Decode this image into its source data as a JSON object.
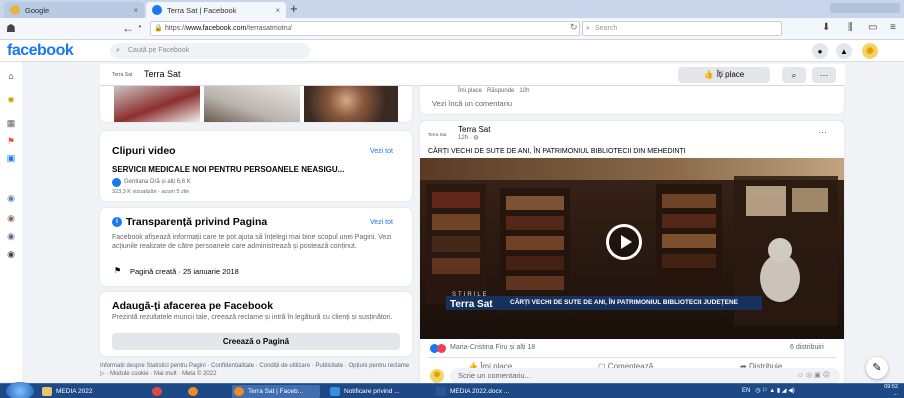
{
  "browser": {
    "tabs": [
      {
        "label": "Google",
        "active": false,
        "icon": "google-icon"
      },
      {
        "label": "Terra Sat | Facebook",
        "active": true,
        "icon": "facebook-icon"
      }
    ],
    "url_prefix": "https://",
    "url_host": "www.facebook.com",
    "url_path": "/terrasatmotru/",
    "search_placeholder": "Search"
  },
  "facebook": {
    "logo": "facebook",
    "search_placeholder": "Caută pe Facebook",
    "brand_color": "#1877f2"
  },
  "page": {
    "mini_logo": "Terra Sat",
    "name": "Terra Sat",
    "like_label": "Îți place"
  },
  "videos_card": {
    "title": "Clipuri video",
    "see_all": "Vezi tot",
    "video_title": "SERVICII MEDICALE NOI PENTRU PERSOANELE NEASIGU...",
    "reactions": "Gentiana Dră și alți 6,6 K",
    "stats": "323,3 K vizualizări · acum 5 zile"
  },
  "transparency_card": {
    "title": "Transparență privind Pagina",
    "see_all": "Vezi tot",
    "description": "Facebook afișează informații care te pot ajuta să înțelegi mai bine scopul unei Pagini. Vezi acțiunile realizate de către persoanele care administrează și postează conținut.",
    "created": "Pagină creată · 25 ianuarie 2018"
  },
  "business_card": {
    "title": "Adaugă-ți afacerea pe Facebook",
    "description": "Prezintă rezultatele muncii tale, creează reclame și intră în legătură cu clienți și susținători.",
    "button": "Creează o Pagină"
  },
  "footer": {
    "text": "Informații despre Statistici pentru Pagini · Confidențialitate · Condiții de utilizare · Publicitate · Opțiuni pentru reclame ▷ · Module cookie · Mai mult · Meta © 2022"
  },
  "comment_card": {
    "like": "Îmi place",
    "reply": "Răspunde",
    "time": "10h",
    "more_comments": "Vezi încă un comentariu"
  },
  "post": {
    "author": "Terra Sat",
    "time": "12h · ",
    "title": "CĂRȚI VECHI DE SUTE DE ANI, ÎN PATRIMONIUL BIBLIOTECII DIN MEHEDINȚI",
    "lower_third_tag": "STIRILE",
    "lower_third_brand": "Terra Sat",
    "lower_third_headline": "CĂRȚI VECHI DE SUTE DE ANI, ÎN PATRIMONIUL BIBLIOTECII JUDEȚENE",
    "reactions": "Maria-Cristina Firu și alți 18",
    "shares": "6 distribuiri",
    "action_like": "Îmi place",
    "action_comment": "Comentează",
    "action_share": "Distribuie",
    "comment_placeholder": "Scrie un comentariu..."
  },
  "taskbar": {
    "tasks": [
      {
        "label": "MEDIA  2022"
      },
      {
        "label": ""
      },
      {
        "label": ""
      },
      {
        "label": "Terra Sat | Faceb..."
      },
      {
        "label": "Notificare privind ..."
      },
      {
        "label": "MEDIA 2022.docx ..."
      }
    ],
    "tray_lang": "EN",
    "clock_time": "09:52",
    "clock_date": "..."
  }
}
